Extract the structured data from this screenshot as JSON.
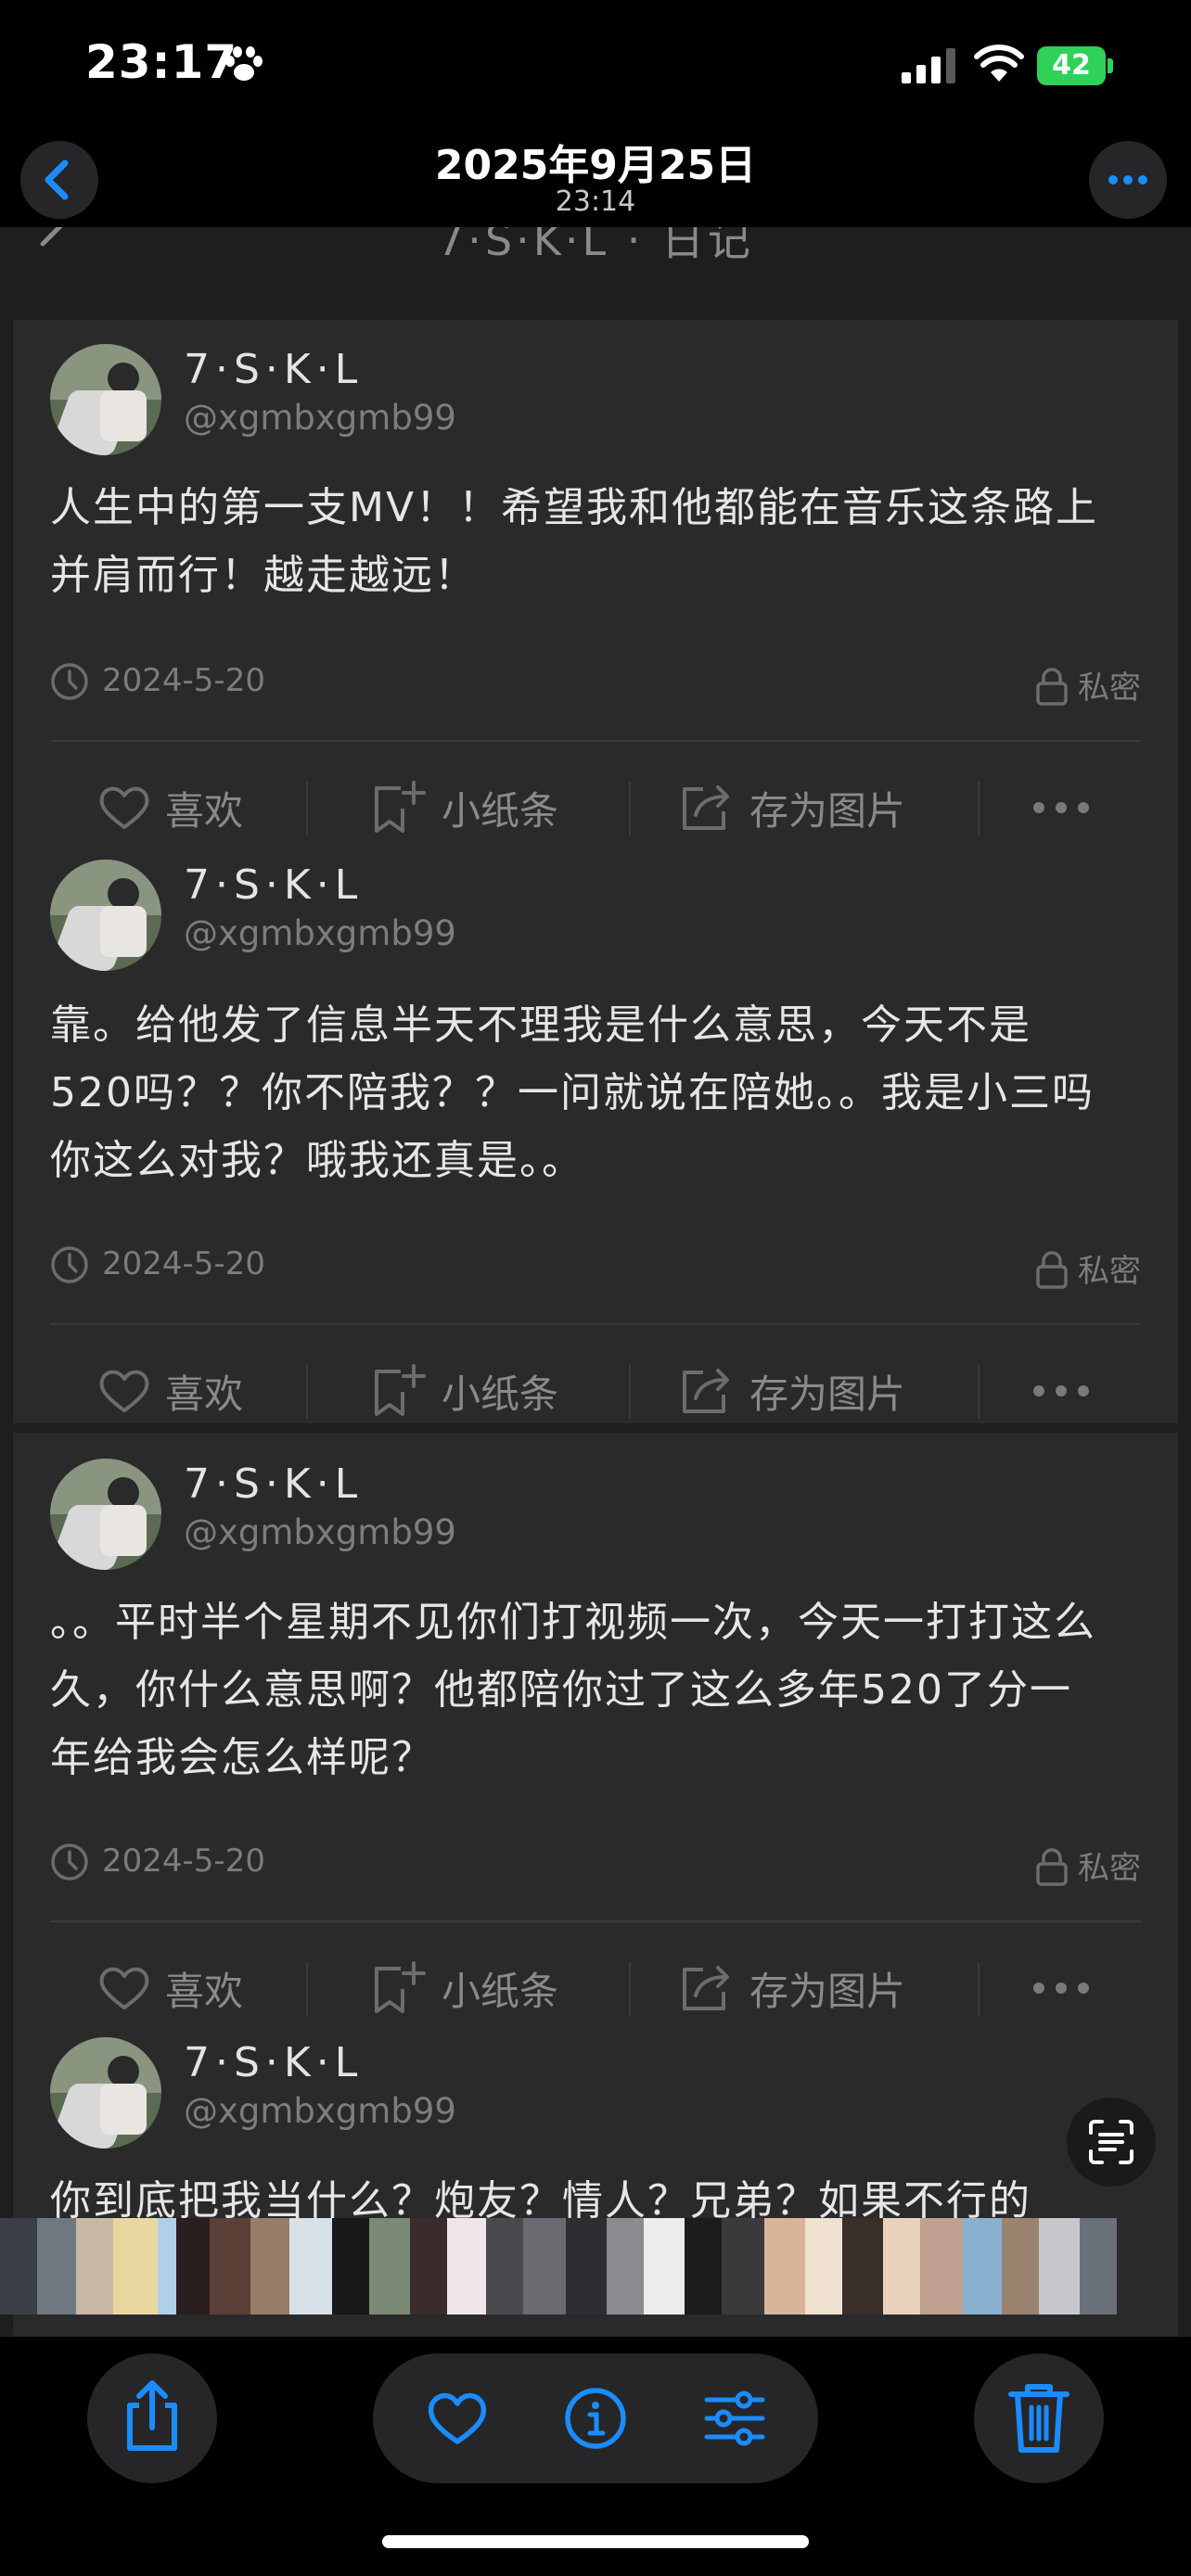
{
  "status": {
    "time": "23:17",
    "battery": "42"
  },
  "header": {
    "date": "2025年9月25日",
    "time": "23:14"
  },
  "app": {
    "nav_title": "7·S·K·L · 日记"
  },
  "actions": {
    "like": "喜欢",
    "note": "小纸条",
    "save_image": "存为图片"
  },
  "posts": [
    {
      "username": "7·S·K·L",
      "handle": "@xgmbxgmb99",
      "lines": [
        "人生中的第一支MV！！希望我和他都能在音乐这条路上",
        "并肩而行！越走越远！"
      ],
      "date": "2024-5-20",
      "privacy": "私密"
    },
    {
      "username": "7·S·K·L",
      "handle": "@xgmbxgmb99",
      "lines": [
        "靠。给他发了信息半天不理我是什么意思，今天不是",
        "520吗？？你不陪我？？一问就说在陪她。。我是小三吗",
        "你这么对我？哦我还真是。。"
      ],
      "date": "2024-5-20",
      "privacy": "私密"
    },
    {
      "username": "7·S·K·L",
      "handle": "@xgmbxgmb99",
      "lines": [
        "。。平时半个星期不见你们打视频一次，今天一打打这么",
        "久，你什么意思啊？他都陪你过了这么多年520了分一",
        "年给我会怎么样呢？"
      ],
      "date": "2024-5-20",
      "privacy": "私密"
    },
    {
      "username": "7·S·K·L",
      "handle": "@xgmbxgmb99",
      "lines": [
        "你到底把我当什么？炮友？情人？兄弟？如果不行的"
      ]
    }
  ],
  "colors": {
    "accent": "#1a8cff",
    "background": "#000000",
    "card": "#2a2a2b"
  },
  "icons": [
    "paw-icon",
    "signal-icon",
    "wifi-icon",
    "battery-icon",
    "chevron-left-icon",
    "ellipsis-icon",
    "clock-icon",
    "lock-icon",
    "heart-icon",
    "note-add-icon",
    "share-square-icon",
    "scan-text-icon",
    "share-icon",
    "info-icon",
    "adjust-icon",
    "trash-icon"
  ]
}
